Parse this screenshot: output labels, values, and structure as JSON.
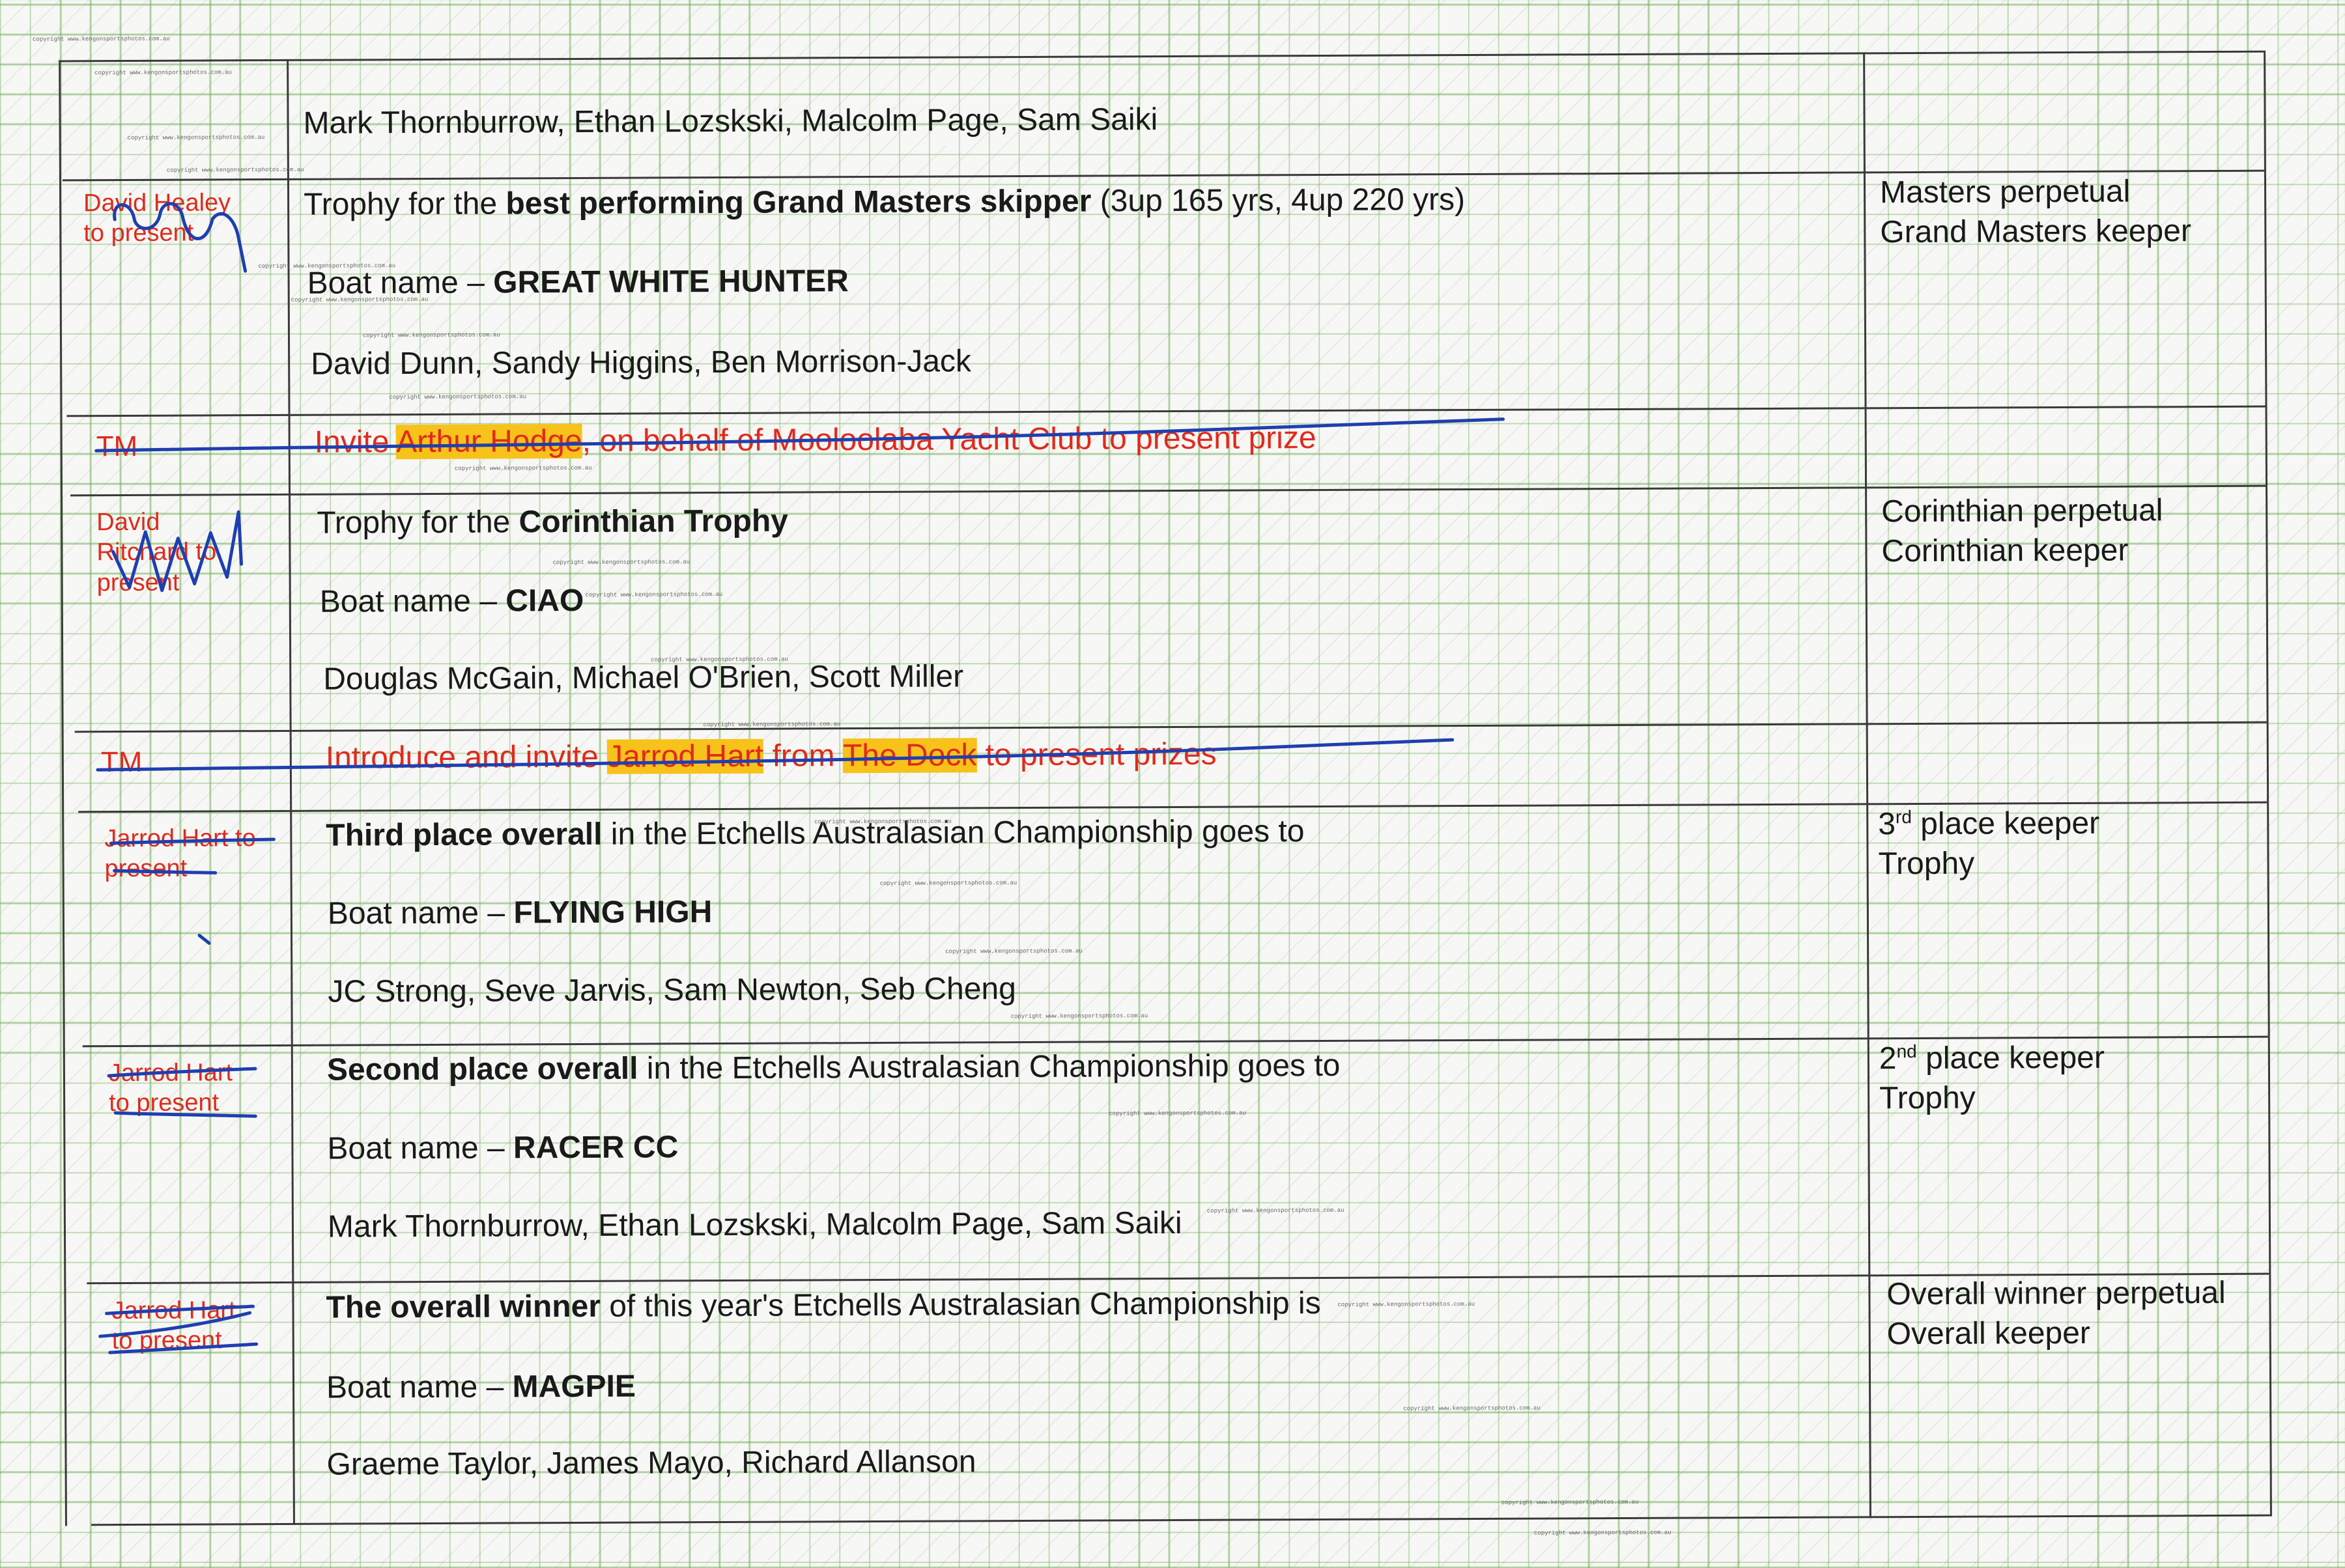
{
  "watermark": "copyright www.kengonsportsphotos.com.au",
  "rows": [
    {
      "crew": "Mark Thornburrow, Ethan Lozskski, Malcolm Page, Sam Saiki"
    },
    {
      "presenter": [
        "David Healey",
        "to present"
      ],
      "trophy_prefix": "Trophy for the ",
      "trophy_bold": "best performing Grand Masters skipper",
      "trophy_suffix": "  (3up 165 yrs, 4up 220 yrs)",
      "boat_prefix": "Boat name – ",
      "boat": "GREAT WHITE HUNTER",
      "crew": "David Dunn, Sandy Higgins, Ben Morrison-Jack",
      "keeper": [
        "Masters perpetual",
        "Grand Masters keeper"
      ]
    },
    {
      "presenter": "TM",
      "text_a": "Invite ",
      "text_hl": "Arthur Hodge",
      "text_b": ", on behalf of Mooloolaba Yacht Club to present prize"
    },
    {
      "presenter": [
        "David",
        "Ritchard to",
        "present"
      ],
      "trophy_prefix": "Trophy for the ",
      "trophy_bold": "Corinthian Trophy",
      "boat_prefix": "Boat name – ",
      "boat": "CIAO",
      "crew": "Douglas McGain, Michael O'Brien, Scott Miller",
      "keeper": [
        "Corinthian perpetual",
        "Corinthian keeper"
      ]
    },
    {
      "presenter": "TM",
      "text_a": "Introduce and invite ",
      "text_hl": "Jarrod Hart",
      "text_b": " from ",
      "text_hl2": "The Dock",
      "text_c": " to present prizes"
    },
    {
      "presenter": [
        "Jarrod Hart to",
        "present"
      ],
      "title_bold": "Third place overall",
      "title_rest": " in the Etchells Australasian Championship goes to",
      "boat_prefix": "Boat name – ",
      "boat": "FLYING HIGH",
      "crew": "JC Strong, Seve Jarvis, Sam Newton, Seb Cheng",
      "keeper_num": "3",
      "keeper_sup": "rd",
      "keeper_rest": " place keeper",
      "keeper2": "Trophy"
    },
    {
      "presenter": [
        "Jarrod Hart",
        "to present"
      ],
      "title_bold": "Second place overall",
      "title_rest": " in the Etchells Australasian Championship goes to",
      "boat_prefix": "Boat name – ",
      "boat": "RACER CC",
      "crew": "Mark Thornburrow, Ethan Lozskski, Malcolm Page, Sam Saiki",
      "keeper_num": "2",
      "keeper_sup": "nd",
      "keeper_rest": " place keeper",
      "keeper2": "Trophy"
    },
    {
      "presenter": [
        "Jarrod Hart",
        "to present"
      ],
      "title_bold": "The overall winner",
      "title_rest": " of this year's Etchells Australasian Championship is",
      "boat_prefix": "Boat name – ",
      "boat": "MAGPIE",
      "crew": "Graeme Taylor, James Mayo, Richard Allanson",
      "keeper": [
        "Overall winner perpetual",
        "Overall keeper"
      ]
    }
  ],
  "colors": {
    "grid": "#6faf5a",
    "handwriting_red": "#e02a1c",
    "pen_blue": "#1f3fb0",
    "highlight": "#f7c21a"
  }
}
